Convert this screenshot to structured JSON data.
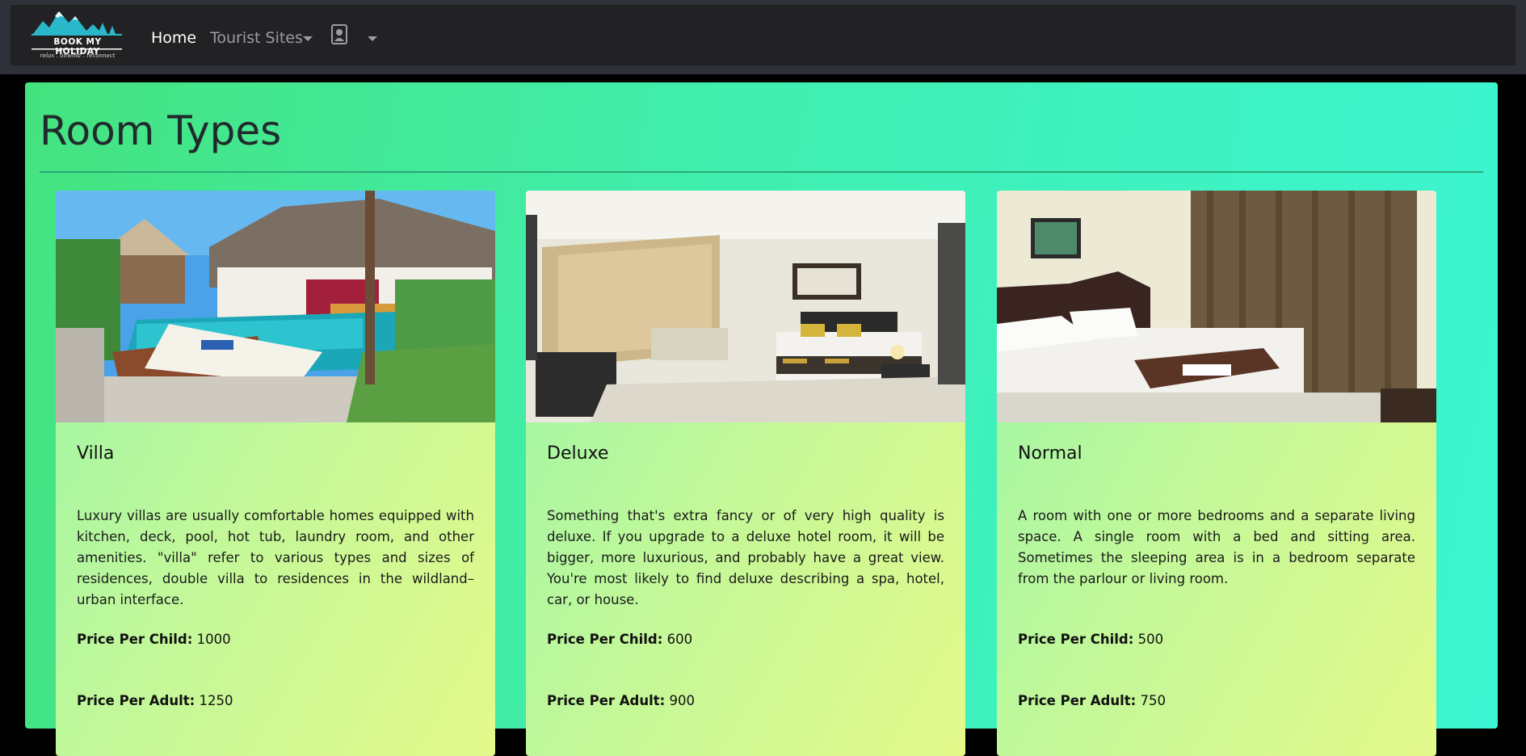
{
  "navbar": {
    "brand_name": "BOOK MY HOLIDAY",
    "brand_tagline": "relax . unwind . reconnect",
    "home_label": "Home",
    "sites_label": "Tourist Sites",
    "profile_icon": "contact-icon",
    "caret_icon": "caret-down-icon"
  },
  "main": {
    "title": "Room Types"
  },
  "rooms": [
    {
      "name": "Villa",
      "description": "Luxury villas are usually comfortable homes equipped with kitchen, deck, pool, hot tub, laundry room, and other amenities. \"villa\" refer to various types and sizes of residences, double villa to residences in the wildland–urban interface.",
      "child_label": "Price Per Child:",
      "child_price": "1000",
      "adult_label": "Price Per Adult:",
      "adult_price": "1250"
    },
    {
      "name": "Deluxe",
      "description": "Something that's extra fancy or of very high quality is deluxe. If you upgrade to a deluxe hotel room, it will be bigger, more luxurious, and probably have a great view. You're most likely to find deluxe describing a spa, hotel, car, or house.",
      "child_label": "Price Per Child:",
      "child_price": "600",
      "adult_label": "Price Per Adult:",
      "adult_price": "900"
    },
    {
      "name": "Normal",
      "description": "A room with one or more bedrooms and a separate living space. A single room with a bed and sitting area. Sometimes the sleeping area is in a bedroom separate from the parlour or living room.",
      "child_label": "Price Per Child:",
      "child_price": "500",
      "adult_label": "Price Per Adult:",
      "adult_price": "750"
    }
  ],
  "colors": {
    "navbar_bg": "#222224",
    "main_gradient_start": "#45e37f",
    "main_gradient_end": "#3cf6d2",
    "card_gradient_start": "#9af6a9",
    "card_gradient_end": "#e4f98b",
    "title_text": "#212a2c"
  }
}
